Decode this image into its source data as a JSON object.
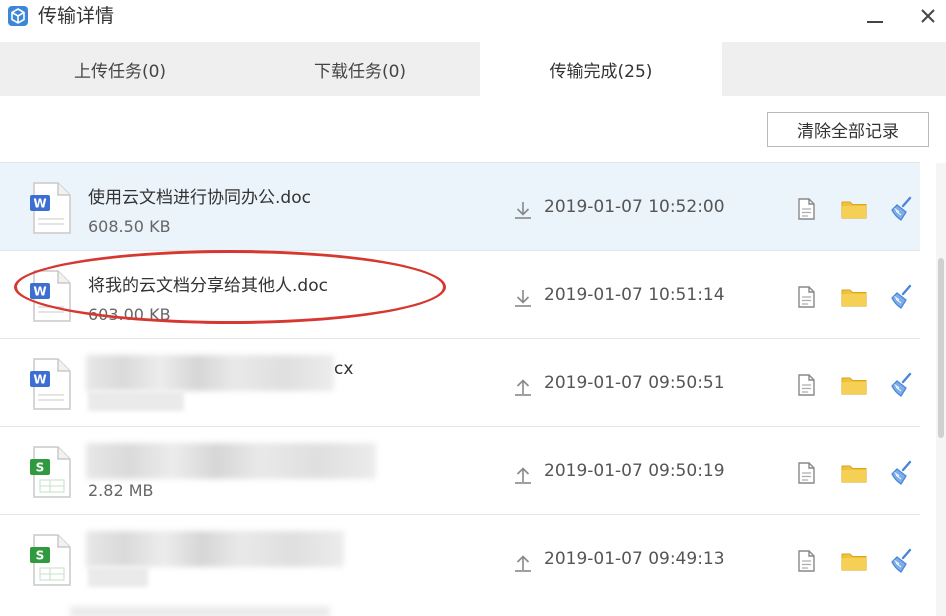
{
  "window": {
    "title": "传输详情",
    "accent_color": "#3d86d8"
  },
  "tabs": [
    {
      "label": "上传任务(0)",
      "active": false
    },
    {
      "label": "下载任务(0)",
      "active": false
    },
    {
      "label": "传输完成(25)",
      "active": true
    }
  ],
  "toolbar": {
    "clear_label": "清除全部记录"
  },
  "rows": [
    {
      "name": "使用云文档进行协同办公.doc",
      "size": "608.50 KB",
      "direction": "download",
      "time": "2019-01-07 10:52:00",
      "type": "word",
      "selected": true
    },
    {
      "name": "将我的云文档分享给其他人.doc",
      "size": "603.00 KB",
      "direction": "download",
      "time": "2019-01-07 10:51:14",
      "type": "word",
      "selected": false
    },
    {
      "name": "cx",
      "size": "",
      "direction": "upload",
      "time": "2019-01-07 09:50:51",
      "type": "word",
      "selected": false
    },
    {
      "name": "",
      "size": "2.82 MB",
      "direction": "upload",
      "time": "2019-01-07 09:50:19",
      "type": "sheet",
      "selected": false
    },
    {
      "name": "",
      "size": "",
      "direction": "upload",
      "time": "2019-01-07 09:49:13",
      "type": "sheet",
      "selected": false
    }
  ],
  "icons": {
    "word_color": "#3d6fd1",
    "sheet_color": "#2f9b3e",
    "folder_color": "#f0c23b",
    "clean_color": "#4a86d8"
  }
}
